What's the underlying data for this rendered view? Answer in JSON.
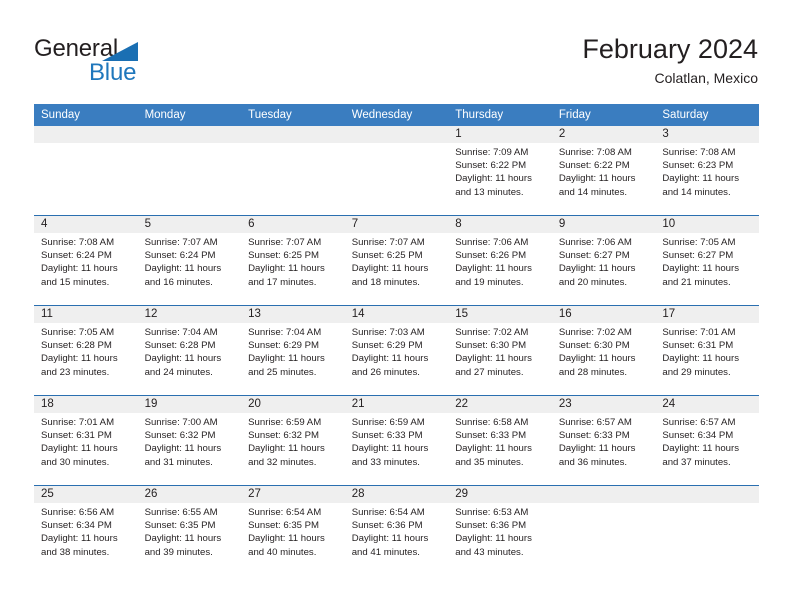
{
  "brand": {
    "name_part1": "General",
    "name_part2": "Blue",
    "flag_icon": "triangle-flag-icon"
  },
  "header": {
    "title": "February 2024",
    "subtitle": "Colatlan, Mexico"
  },
  "colors": {
    "header_blue": "#3a7dc0",
    "row_divider": "#2a6fb0",
    "daynum_band": "#efefef",
    "brand_blue": "#1f77bc",
    "text": "#231f20"
  },
  "weekday_headers": [
    "Sunday",
    "Monday",
    "Tuesday",
    "Wednesday",
    "Thursday",
    "Friday",
    "Saturday"
  ],
  "weeks": [
    [
      {
        "day": "",
        "lines": [
          "",
          "",
          "",
          ""
        ],
        "empty": true
      },
      {
        "day": "",
        "lines": [
          "",
          "",
          "",
          ""
        ],
        "empty": true
      },
      {
        "day": "",
        "lines": [
          "",
          "",
          "",
          ""
        ],
        "empty": true
      },
      {
        "day": "",
        "lines": [
          "",
          "",
          "",
          ""
        ],
        "empty": true
      },
      {
        "day": "1",
        "lines": [
          "Sunrise: 7:09 AM",
          "Sunset: 6:22 PM",
          "Daylight: 11 hours",
          "and 13 minutes."
        ],
        "empty": false
      },
      {
        "day": "2",
        "lines": [
          "Sunrise: 7:08 AM",
          "Sunset: 6:22 PM",
          "Daylight: 11 hours",
          "and 14 minutes."
        ],
        "empty": false
      },
      {
        "day": "3",
        "lines": [
          "Sunrise: 7:08 AM",
          "Sunset: 6:23 PM",
          "Daylight: 11 hours",
          "and 14 minutes."
        ],
        "empty": false
      }
    ],
    [
      {
        "day": "4",
        "lines": [
          "Sunrise: 7:08 AM",
          "Sunset: 6:24 PM",
          "Daylight: 11 hours",
          "and 15 minutes."
        ],
        "empty": false
      },
      {
        "day": "5",
        "lines": [
          "Sunrise: 7:07 AM",
          "Sunset: 6:24 PM",
          "Daylight: 11 hours",
          "and 16 minutes."
        ],
        "empty": false
      },
      {
        "day": "6",
        "lines": [
          "Sunrise: 7:07 AM",
          "Sunset: 6:25 PM",
          "Daylight: 11 hours",
          "and 17 minutes."
        ],
        "empty": false
      },
      {
        "day": "7",
        "lines": [
          "Sunrise: 7:07 AM",
          "Sunset: 6:25 PM",
          "Daylight: 11 hours",
          "and 18 minutes."
        ],
        "empty": false
      },
      {
        "day": "8",
        "lines": [
          "Sunrise: 7:06 AM",
          "Sunset: 6:26 PM",
          "Daylight: 11 hours",
          "and 19 minutes."
        ],
        "empty": false
      },
      {
        "day": "9",
        "lines": [
          "Sunrise: 7:06 AM",
          "Sunset: 6:27 PM",
          "Daylight: 11 hours",
          "and 20 minutes."
        ],
        "empty": false
      },
      {
        "day": "10",
        "lines": [
          "Sunrise: 7:05 AM",
          "Sunset: 6:27 PM",
          "Daylight: 11 hours",
          "and 21 minutes."
        ],
        "empty": false
      }
    ],
    [
      {
        "day": "11",
        "lines": [
          "Sunrise: 7:05 AM",
          "Sunset: 6:28 PM",
          "Daylight: 11 hours",
          "and 23 minutes."
        ],
        "empty": false
      },
      {
        "day": "12",
        "lines": [
          "Sunrise: 7:04 AM",
          "Sunset: 6:28 PM",
          "Daylight: 11 hours",
          "and 24 minutes."
        ],
        "empty": false
      },
      {
        "day": "13",
        "lines": [
          "Sunrise: 7:04 AM",
          "Sunset: 6:29 PM",
          "Daylight: 11 hours",
          "and 25 minutes."
        ],
        "empty": false
      },
      {
        "day": "14",
        "lines": [
          "Sunrise: 7:03 AM",
          "Sunset: 6:29 PM",
          "Daylight: 11 hours",
          "and 26 minutes."
        ],
        "empty": false
      },
      {
        "day": "15",
        "lines": [
          "Sunrise: 7:02 AM",
          "Sunset: 6:30 PM",
          "Daylight: 11 hours",
          "and 27 minutes."
        ],
        "empty": false
      },
      {
        "day": "16",
        "lines": [
          "Sunrise: 7:02 AM",
          "Sunset: 6:30 PM",
          "Daylight: 11 hours",
          "and 28 minutes."
        ],
        "empty": false
      },
      {
        "day": "17",
        "lines": [
          "Sunrise: 7:01 AM",
          "Sunset: 6:31 PM",
          "Daylight: 11 hours",
          "and 29 minutes."
        ],
        "empty": false
      }
    ],
    [
      {
        "day": "18",
        "lines": [
          "Sunrise: 7:01 AM",
          "Sunset: 6:31 PM",
          "Daylight: 11 hours",
          "and 30 minutes."
        ],
        "empty": false
      },
      {
        "day": "19",
        "lines": [
          "Sunrise: 7:00 AM",
          "Sunset: 6:32 PM",
          "Daylight: 11 hours",
          "and 31 minutes."
        ],
        "empty": false
      },
      {
        "day": "20",
        "lines": [
          "Sunrise: 6:59 AM",
          "Sunset: 6:32 PM",
          "Daylight: 11 hours",
          "and 32 minutes."
        ],
        "empty": false
      },
      {
        "day": "21",
        "lines": [
          "Sunrise: 6:59 AM",
          "Sunset: 6:33 PM",
          "Daylight: 11 hours",
          "and 33 minutes."
        ],
        "empty": false
      },
      {
        "day": "22",
        "lines": [
          "Sunrise: 6:58 AM",
          "Sunset: 6:33 PM",
          "Daylight: 11 hours",
          "and 35 minutes."
        ],
        "empty": false
      },
      {
        "day": "23",
        "lines": [
          "Sunrise: 6:57 AM",
          "Sunset: 6:33 PM",
          "Daylight: 11 hours",
          "and 36 minutes."
        ],
        "empty": false
      },
      {
        "day": "24",
        "lines": [
          "Sunrise: 6:57 AM",
          "Sunset: 6:34 PM",
          "Daylight: 11 hours",
          "and 37 minutes."
        ],
        "empty": false
      }
    ],
    [
      {
        "day": "25",
        "lines": [
          "Sunrise: 6:56 AM",
          "Sunset: 6:34 PM",
          "Daylight: 11 hours",
          "and 38 minutes."
        ],
        "empty": false
      },
      {
        "day": "26",
        "lines": [
          "Sunrise: 6:55 AM",
          "Sunset: 6:35 PM",
          "Daylight: 11 hours",
          "and 39 minutes."
        ],
        "empty": false
      },
      {
        "day": "27",
        "lines": [
          "Sunrise: 6:54 AM",
          "Sunset: 6:35 PM",
          "Daylight: 11 hours",
          "and 40 minutes."
        ],
        "empty": false
      },
      {
        "day": "28",
        "lines": [
          "Sunrise: 6:54 AM",
          "Sunset: 6:36 PM",
          "Daylight: 11 hours",
          "and 41 minutes."
        ],
        "empty": false
      },
      {
        "day": "29",
        "lines": [
          "Sunrise: 6:53 AM",
          "Sunset: 6:36 PM",
          "Daylight: 11 hours",
          "and 43 minutes."
        ],
        "empty": false
      },
      {
        "day": "",
        "lines": [
          "",
          "",
          "",
          ""
        ],
        "empty": true
      },
      {
        "day": "",
        "lines": [
          "",
          "",
          "",
          ""
        ],
        "empty": true
      }
    ]
  ]
}
